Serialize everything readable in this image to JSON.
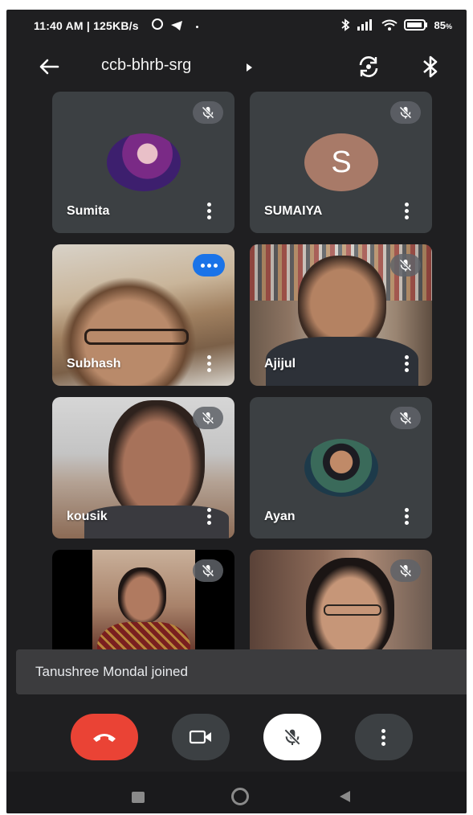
{
  "status_bar": {
    "time": "11:40 AM | 125KB/s",
    "battery": "85",
    "battery_unit": "%"
  },
  "app_bar": {
    "meeting_code": "ccb-bhrb-srg"
  },
  "participants": [
    {
      "name": "Sumita",
      "muted": true,
      "type": "avatar-photo"
    },
    {
      "name": "SUMAIYA",
      "muted": true,
      "type": "avatar-letter",
      "initial": "S",
      "avatar_color": "#a87a68"
    },
    {
      "name": "Subhash",
      "muted": false,
      "speaking": true,
      "type": "video"
    },
    {
      "name": "Ajijul",
      "muted": true,
      "type": "video"
    },
    {
      "name": "kousik",
      "muted": true,
      "type": "video"
    },
    {
      "name": "Ayan",
      "muted": true,
      "type": "avatar-photo"
    },
    {
      "name": "",
      "muted": true,
      "type": "video"
    },
    {
      "name": "",
      "muted": true,
      "type": "video"
    }
  ],
  "toast": {
    "message": "Tanushree Mondal joined"
  },
  "controls": {
    "end_call_color": "#ea4335",
    "camera_icon": "video-camera-icon",
    "mic_icon": "mic-off-icon",
    "more_icon": "more-vert-icon"
  },
  "colors": {
    "background": "#1f1f21",
    "tile": "#3c4043",
    "speaking_indicator": "#1a73e8"
  }
}
